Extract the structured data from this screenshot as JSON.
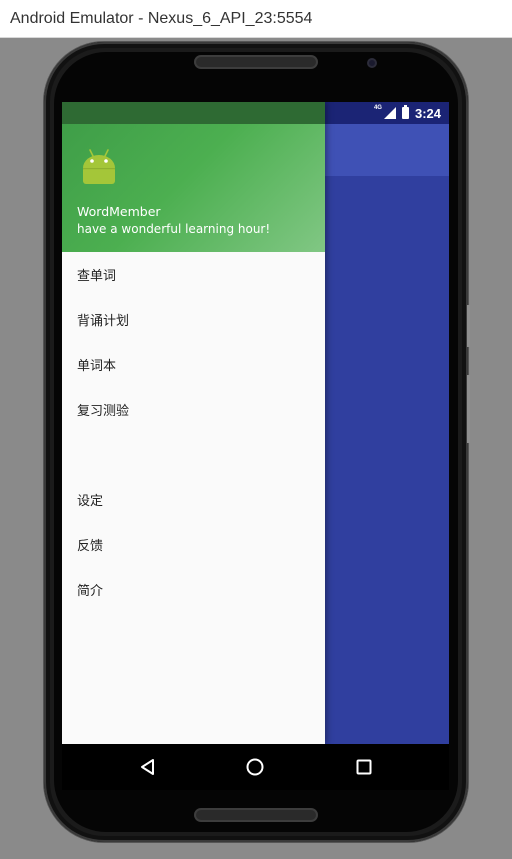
{
  "window": {
    "title": "Android Emulator - Nexus_6_API_23:5554"
  },
  "status_bar": {
    "network": "4G",
    "time": "3:24"
  },
  "drawer": {
    "header": {
      "app_name": "WordMember",
      "tagline": "have a wonderful learning hour!",
      "logo_icon": "android-logo-icon"
    },
    "primary_items": [
      {
        "label": "查单词"
      },
      {
        "label": "背诵计划"
      },
      {
        "label": "单词本"
      },
      {
        "label": "复习测验"
      }
    ],
    "secondary_items": [
      {
        "label": "设定"
      },
      {
        "label": "反馈"
      },
      {
        "label": "简介"
      }
    ]
  },
  "nav_bar": {
    "icons": [
      "back-icon",
      "home-icon",
      "recents-icon"
    ]
  },
  "colors": {
    "primary": "#3F51B5",
    "primary_dark": "#303F9F",
    "drawer_header_green": "#4CAF50",
    "drawer_background": "#FAFAFA"
  }
}
